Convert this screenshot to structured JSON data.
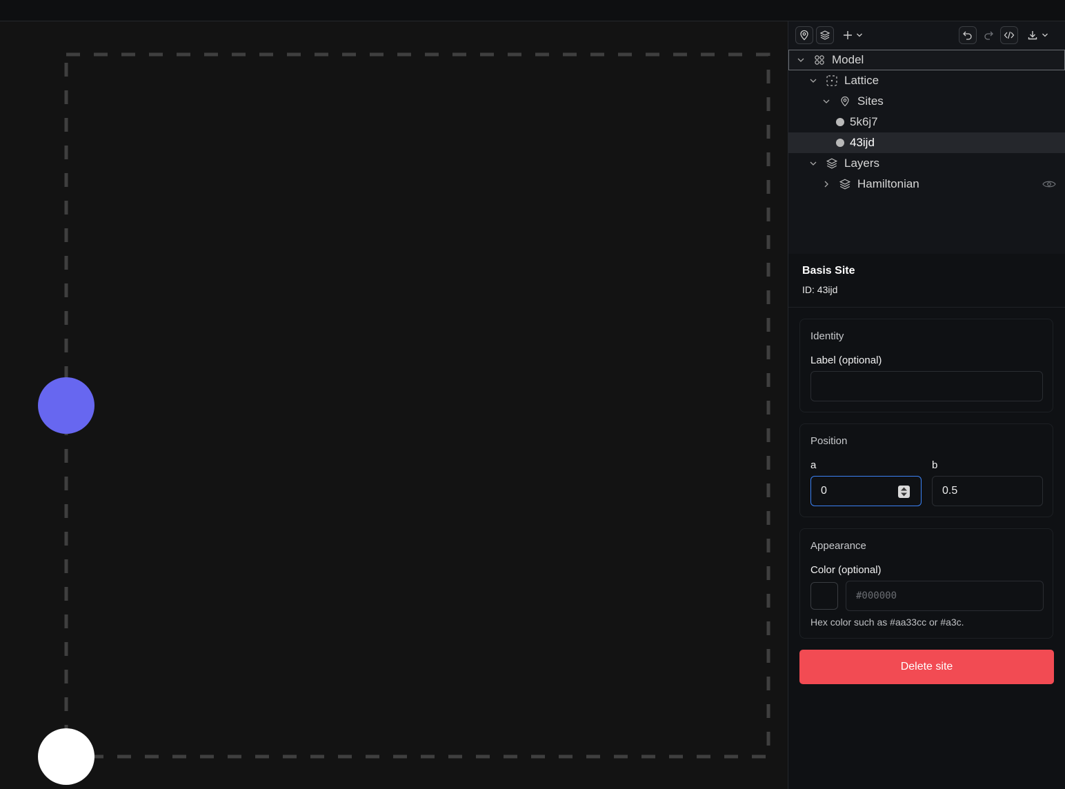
{
  "colors": {
    "site_primary": "#6767f0",
    "site_secondary": "#ffffff",
    "lattice_border": "#3f3f3f",
    "danger": "#f24b53",
    "focus": "#3b82f6"
  },
  "toolbar": {
    "icons": [
      "sites-icon",
      "layers-icon",
      "add-icon",
      "undo-icon",
      "redo-icon",
      "code-icon",
      "download-icon"
    ]
  },
  "tree": {
    "root": "Model",
    "lattice": "Lattice",
    "sites": "Sites",
    "site_items": [
      "5k6j7",
      "43ijd"
    ],
    "layers": "Layers",
    "hamiltonian": "Hamiltonian"
  },
  "inspector": {
    "title": "Basis Site",
    "id_text": "ID: 43ijd",
    "identity": {
      "title": "Identity",
      "label_label": "Label (optional)",
      "label_value": ""
    },
    "position": {
      "title": "Position",
      "a_label": "a",
      "a_value": "0",
      "b_label": "b",
      "b_value": "0.5"
    },
    "appearance": {
      "title": "Appearance",
      "color_label": "Color (optional)",
      "color_placeholder": "#000000",
      "hint": "Hex color such as #aa33cc or #a3c."
    },
    "delete_label": "Delete site"
  }
}
